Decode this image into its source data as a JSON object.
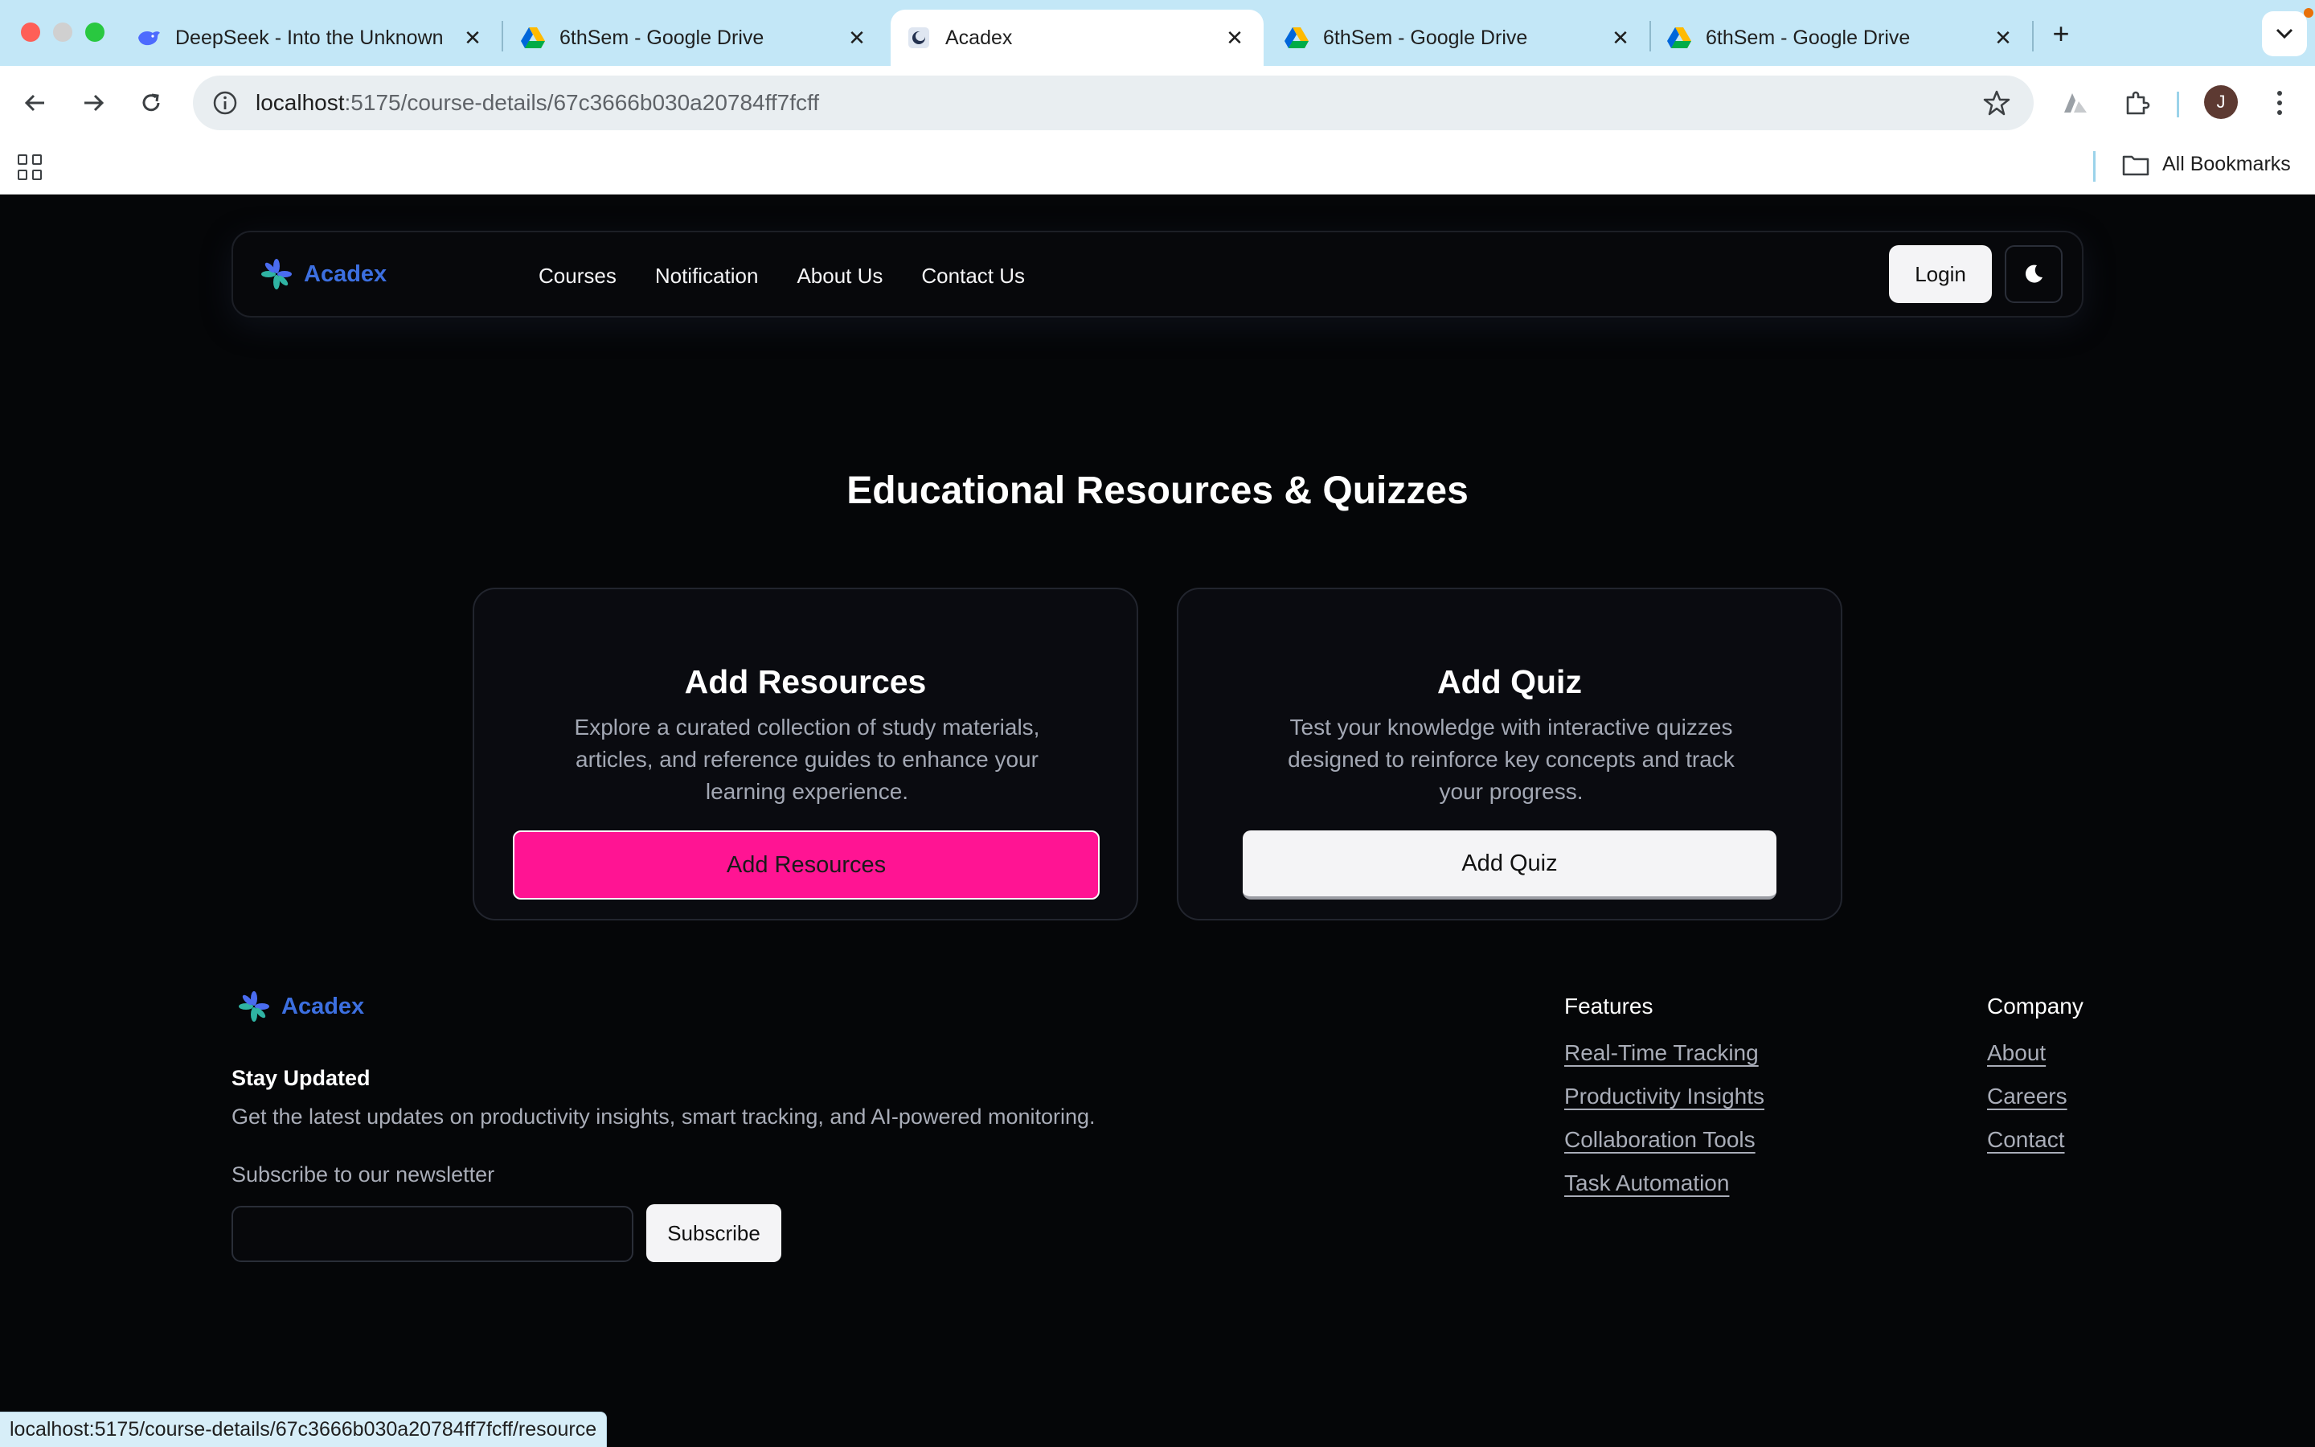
{
  "browser": {
    "tabs": [
      {
        "title": "DeepSeek - Into the Unknown",
        "icon": "deepseek-whale-icon",
        "active": false
      },
      {
        "title": "6thSem - Google Drive",
        "icon": "google-drive-icon",
        "active": false
      },
      {
        "title": "Acadex",
        "icon": "acadex-favicon",
        "active": true
      },
      {
        "title": "6thSem - Google Drive",
        "icon": "google-drive-icon",
        "active": false
      },
      {
        "title": "6thSem - Google Drive",
        "icon": "google-drive-icon",
        "active": false
      }
    ],
    "new_tab_label": "+",
    "url_host": "localhost",
    "url_path": ":5175/course-details/67c3666b030a20784ff7fcff",
    "avatar_initial": "J",
    "all_bookmarks_label": "All Bookmarks",
    "status_url": "localhost:5175/course-details/67c3666b030a20784ff7fcff/resource"
  },
  "colors": {
    "page_bg": "#050608",
    "brand_blue": "#3c6fe0",
    "accent_pink": "#ff1493",
    "muted_text": "#a3a8b4"
  },
  "nav": {
    "brand": "Acadex",
    "links": [
      "Courses",
      "Notification",
      "About Us",
      "Contact Us"
    ],
    "login_label": "Login",
    "theme_icon": "moon-icon"
  },
  "main": {
    "title": "Educational Resources & Quizzes",
    "cards": [
      {
        "title": "Add Resources",
        "description": "Explore a curated collection of study materials, articles, and reference guides to enhance your learning experience.",
        "button_label": "Add Resources"
      },
      {
        "title": "Add Quiz",
        "description": "Test your knowledge with interactive quizzes designed to reinforce key concepts and track your progress.",
        "button_label": "Add Quiz"
      }
    ]
  },
  "footer": {
    "brand": "Acadex",
    "stay_title": "Stay Updated",
    "stay_desc": "Get the latest updates on productivity insights, smart tracking, and AI-powered monitoring.",
    "newsletter_label": "Subscribe to our newsletter",
    "subscribe_label": "Subscribe",
    "features": {
      "heading": "Features",
      "links": [
        "Real-Time Tracking",
        "Productivity Insights",
        "Collaboration Tools",
        "Task Automation"
      ]
    },
    "company": {
      "heading": "Company",
      "links": [
        "About",
        "Careers",
        "Contact"
      ]
    }
  }
}
